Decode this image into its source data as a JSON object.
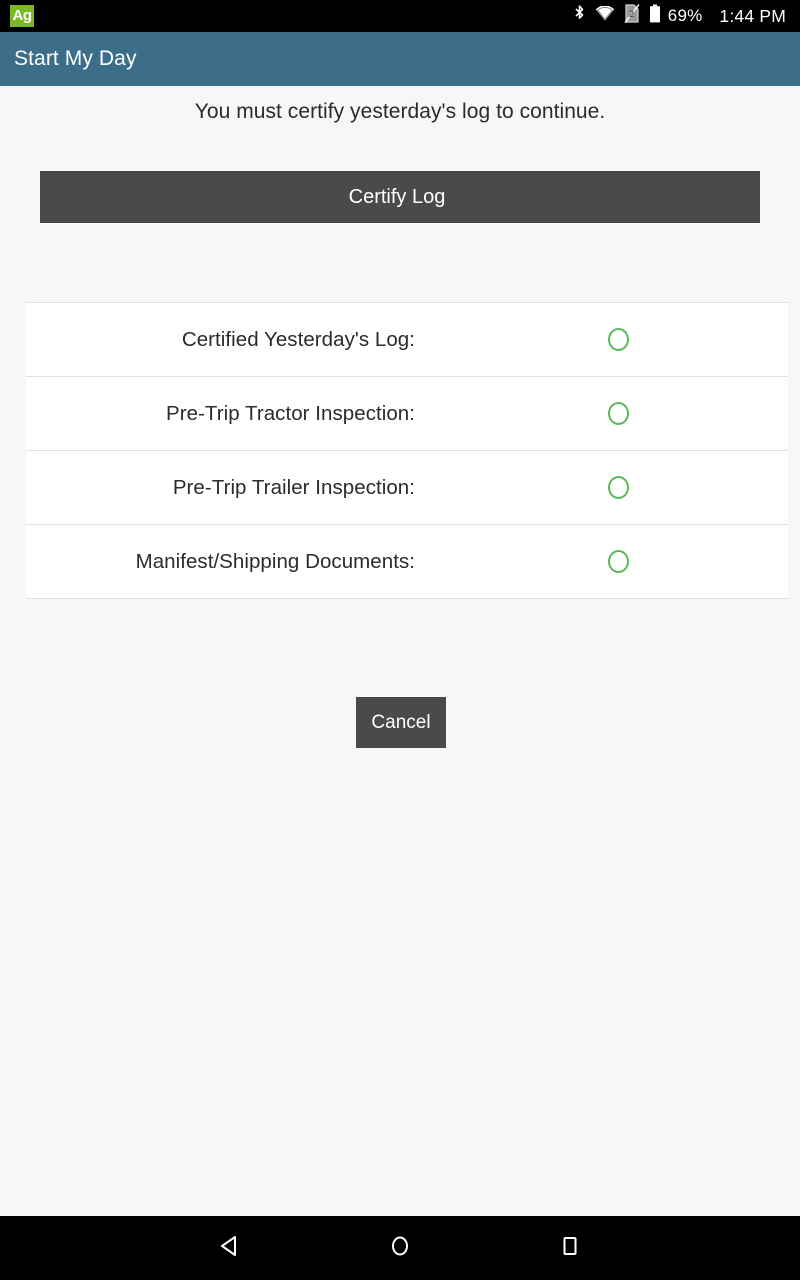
{
  "status_bar": {
    "app_badge_label": "Ag",
    "icons": [
      "bluetooth-icon",
      "wifi-icon",
      "sim-card-missing-icon",
      "battery-icon"
    ],
    "battery_percent": "69%",
    "time": "1:44 PM"
  },
  "app_bar": {
    "title": "Start My Day"
  },
  "main": {
    "notice": "You must certify yesterday's log to continue.",
    "certify_button_label": "Certify Log",
    "cancel_button_label": "Cancel",
    "checklist": [
      {
        "label": "Certified Yesterday's Log:",
        "status": "incomplete",
        "icon": "empty-circle-icon"
      },
      {
        "label": "Pre-Trip Tractor Inspection:",
        "status": "incomplete",
        "icon": "empty-circle-icon"
      },
      {
        "label": "Pre-Trip Trailer Inspection:",
        "status": "incomplete",
        "icon": "empty-circle-icon"
      },
      {
        "label": "Manifest/Shipping Documents:",
        "status": "incomplete",
        "icon": "empty-circle-icon"
      }
    ]
  },
  "nav_bar": {
    "buttons": [
      "back-icon",
      "home-icon",
      "recents-icon"
    ]
  },
  "colors": {
    "app_bar": "#3d6e89",
    "button": "#4a4a48",
    "status_ring": "#5db85c",
    "page_background": "#f7f7f7",
    "row_background": "#ffffff",
    "badge_green": "#7cb728"
  }
}
